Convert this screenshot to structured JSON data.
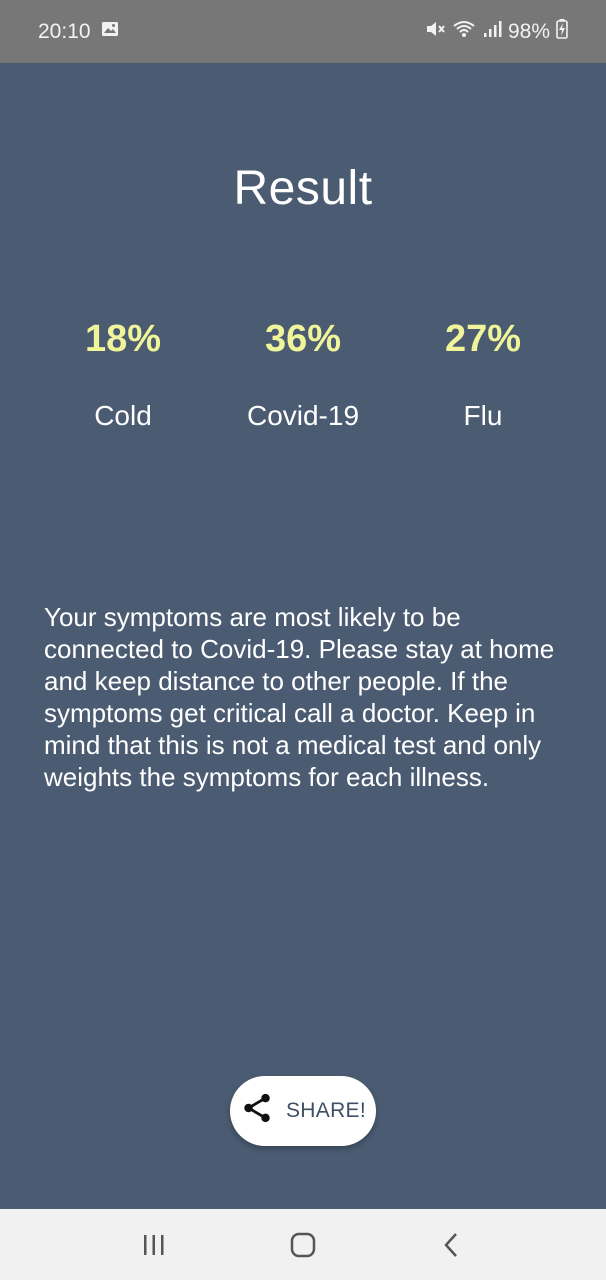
{
  "status_bar": {
    "time": "20:10",
    "battery": "98%",
    "icons": [
      "image-icon",
      "mute-icon",
      "wifi-icon",
      "signal-icon",
      "battery-charging-icon"
    ]
  },
  "main": {
    "title": "Result",
    "results": [
      {
        "percent": "18%",
        "label": "Cold"
      },
      {
        "percent": "36%",
        "label": "Covid-19"
      },
      {
        "percent": "27%",
        "label": "Flu"
      }
    ],
    "message": "Your symptoms are most likely to be connected to Covid-19. Please stay at home and keep distance to other people. If the symptoms get critical call a doctor. Keep in mind that this is not a medical test and only weights the symptoms for each illness.",
    "share_label": "SHARE!"
  },
  "nav_bar": {
    "icons": [
      "recent-apps-icon",
      "home-icon",
      "back-icon"
    ]
  },
  "colors": {
    "background": "#4a5b72",
    "status_bar": "#777777",
    "percent_text": "#f0f59a",
    "nav_bar": "#f1f1f1"
  }
}
